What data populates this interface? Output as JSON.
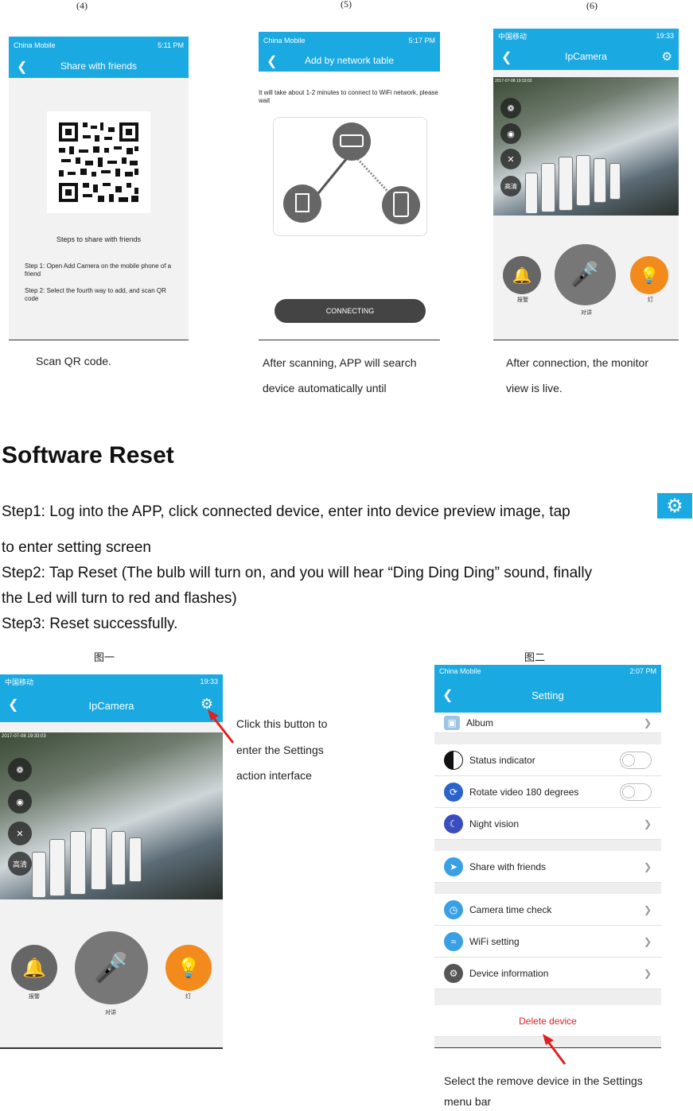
{
  "top_figures": {
    "labels": [
      "(4)",
      "(5)",
      "(6)"
    ],
    "fig4": {
      "status_carrier": "China Mobile",
      "status_time": "5:11 PM",
      "title": "Share with friends",
      "steps_title": "Steps to share with friends",
      "step1": "Step 1: Open Add Camera on the mobile phone of a friend",
      "step2": "Step 2: Select the fourth way to add, and scan QR code",
      "caption": "Scan QR code."
    },
    "fig5": {
      "status_carrier": "China Mobile",
      "status_time": "5:17 PM",
      "title": "Add by network table",
      "wait_text": "It will take about 1-2 minutes to connect to WiFi network, please wait",
      "button": "CONNECTING",
      "caption_line1": "After scanning, APP will search",
      "caption_line2": "device automatically until"
    },
    "fig6": {
      "status_carrier": "中国移动",
      "status_time": "19:33",
      "title": "IpCamera",
      "timestamp": "2017-07-08 19:33:03",
      "hd_label": "高清",
      "alarm_label": "报警",
      "talk_label": "对讲",
      "light_label": "灯",
      "caption_line1": "After connection, the monitor",
      "caption_line2": "view is live."
    }
  },
  "section": {
    "heading": "Software Reset",
    "step1_a": "Step1: Log into the APP, click connected device, enter into device preview image, tap",
    "step1_b": "to enter setting screen",
    "step2_a": "Step2: Tap Reset (The bulb will turn on, and you will hear “Ding Ding Ding” sound, finally",
    "step2_b": "the Led will turn to red and flashes)",
    "step3": "Step3: Reset successfully."
  },
  "bottom_figures": {
    "fig1_label": "图一",
    "fig2_label": "图二",
    "fig1": {
      "status_carrier": "中国移动",
      "status_time": "19:33",
      "title": "IpCamera",
      "timestamp": "2017-07-08 19:33:03",
      "hd_label": "高清",
      "alarm_label": "报警",
      "talk_label": "对讲",
      "light_label": "灯",
      "annotation_line1": "Click this button to",
      "annotation_line2": "enter the Settings",
      "annotation_line3": "action interface"
    },
    "fig2": {
      "status_carrier": "China Mobile",
      "status_time": "2:07 PM",
      "title": "Setting",
      "items": {
        "album": "Album",
        "status_indicator": "Status indicator",
        "rotate": "Rotate video 180 degrees",
        "night_vision": "Night vision",
        "share": "Share with friends",
        "time_check": "Camera time check",
        "wifi": "WiFi setting",
        "device_info": "Device information",
        "delete": "Delete device"
      },
      "caption_line1": "Select the remove device in the Settings",
      "caption_line2": "menu bar"
    }
  },
  "colors": {
    "accent": "#1ba9e1",
    "delete_red": "#e02020",
    "arrow_red": "#e02020",
    "light_orange": "#f28a1c"
  }
}
